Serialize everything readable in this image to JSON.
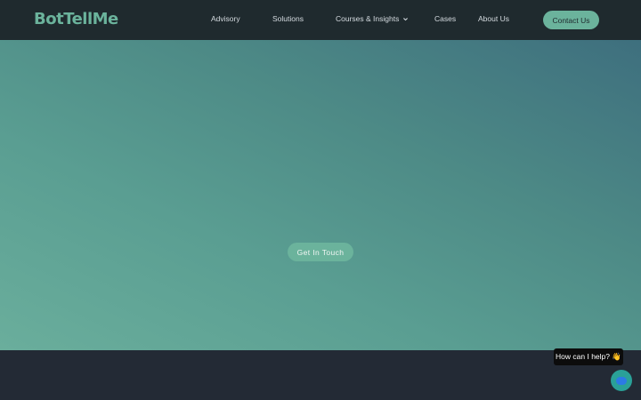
{
  "brand": {
    "logo_text": "BotTellMe",
    "accent": "#6bb39c"
  },
  "nav": {
    "items": [
      {
        "label": "Advisory"
      },
      {
        "label": "Solutions"
      },
      {
        "label": "Courses & Insights",
        "has_dropdown": true
      },
      {
        "label": "Cases"
      },
      {
        "label": "About Us"
      }
    ],
    "contact_label": "Contact Us"
  },
  "hero": {
    "cta_label": "Get In Touch"
  },
  "chat": {
    "prompt": "How can I help? 👋",
    "icon": "chat-bubble-icon"
  }
}
